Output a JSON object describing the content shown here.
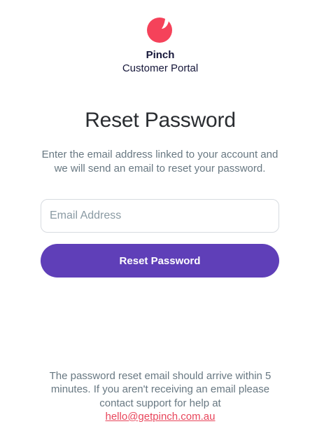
{
  "brand": {
    "name": "Pinch",
    "subtitle": "Customer Portal",
    "logo_icon": "pinch-logo-icon",
    "logo_color": "#f5425a"
  },
  "main": {
    "title": "Reset Password",
    "description": "Enter the email address linked to your account and we will send an email to reset your password.",
    "email_field": {
      "placeholder": "Email Address",
      "value": ""
    },
    "reset_button_label": "Reset Password"
  },
  "footer": {
    "text": "The password reset email should arrive within 5 minutes. If you aren't receiving an email please contact support for help at",
    "support_email": "hello@getpinch.com.au"
  },
  "colors": {
    "primary_button": "#5f3fb8",
    "link": "#e8455b",
    "heading": "#2a2d31",
    "muted_text": "#687882"
  }
}
